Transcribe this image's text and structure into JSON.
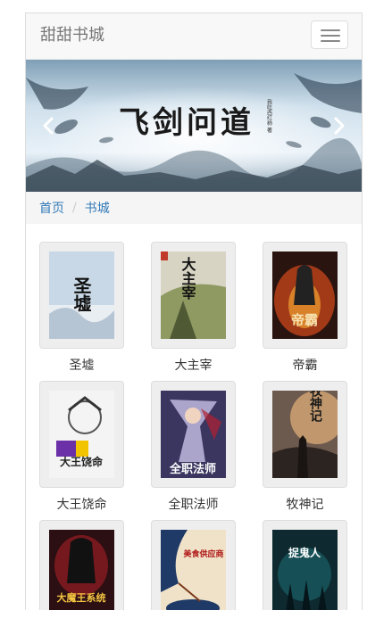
{
  "navbar": {
    "brand": "甜甜书城",
    "toggle_icon": "hamburger-icon"
  },
  "carousel": {
    "banner_title": "飞剑问道",
    "banner_author": "我吃西红柿 著",
    "prev_icon": "chevron-left-icon",
    "next_icon": "chevron-right-icon"
  },
  "breadcrumb": {
    "items": [
      "首页",
      "书城"
    ],
    "link_color": "#337ab7"
  },
  "books": [
    {
      "title": "圣墟",
      "cover_text": "圣墟"
    },
    {
      "title": "大主宰",
      "cover_text": "大主宰"
    },
    {
      "title": "帝霸",
      "cover_text": "帝霸"
    },
    {
      "title": "大王饶命",
      "cover_text": "大王饶命"
    },
    {
      "title": "全职法师",
      "cover_text": "全职法师"
    },
    {
      "title": "牧神记",
      "cover_text": "牧神记"
    },
    {
      "title": "",
      "cover_text": "大魔王系统"
    },
    {
      "title": "",
      "cover_text": "美食供应商"
    },
    {
      "title": "",
      "cover_text": "捉鬼人"
    }
  ]
}
